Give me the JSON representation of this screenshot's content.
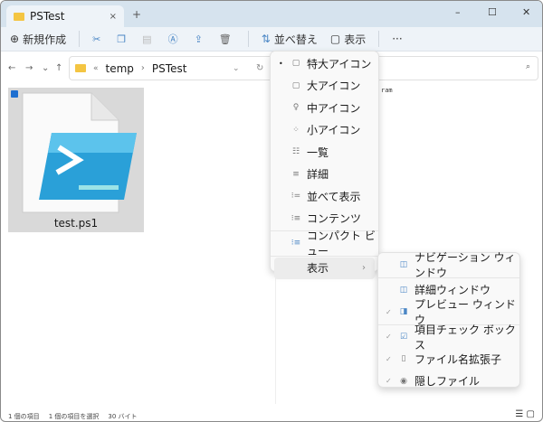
{
  "window": {
    "tab_title": "PSTest",
    "new_tab": "+",
    "close_tab": "×",
    "minimize": "–",
    "maximize": "☐",
    "close": "✕"
  },
  "toolbar": {
    "new": "新規作成",
    "sort": "並べ替え",
    "view": "表示",
    "more": "···"
  },
  "address": {
    "overflow": "«",
    "path": [
      "temp",
      "PSTest"
    ],
    "sep": "›"
  },
  "file": {
    "name": "test.ps1"
  },
  "preview": {
    "text": "ram"
  },
  "status": {
    "count": "1 個の項目",
    "selected": "1 個の項目を選択",
    "size": "30 バイト"
  },
  "view_menu": {
    "items": [
      {
        "label": "特大アイコン",
        "icon": "extra-large-icons-icon",
        "glyph": "▢",
        "bullet": "•"
      },
      {
        "label": "大アイコン",
        "icon": "large-icons-icon",
        "glyph": "▢"
      },
      {
        "label": "中アイコン",
        "icon": "medium-icons-icon",
        "glyph": "♀"
      },
      {
        "label": "小アイコン",
        "icon": "small-icons-icon",
        "glyph": "⁘"
      },
      {
        "label": "一覧",
        "icon": "list-icon",
        "glyph": "☷"
      },
      {
        "label": "詳細",
        "icon": "details-icon",
        "glyph": "≡"
      },
      {
        "label": "並べて表示",
        "icon": "tiles-icon",
        "glyph": "⁝="
      },
      {
        "label": "コンテンツ",
        "icon": "content-icon",
        "glyph": "⁝≡"
      },
      {
        "label": "コンパクト ビュー",
        "icon": "compact-view-icon",
        "glyph": "⁝≡"
      },
      {
        "label": "表示",
        "submenu": true,
        "arrow": "›"
      }
    ]
  },
  "show_submenu": {
    "items": [
      {
        "label": "ナビゲーション ウィンドウ",
        "icon": "navigation-pane-icon",
        "glyph": "◫",
        "checked": false
      },
      {
        "label": "詳細ウィンドウ",
        "icon": "details-pane-icon",
        "glyph": "◫",
        "checked": false
      },
      {
        "label": "プレビュー ウィンドウ",
        "icon": "preview-pane-icon",
        "glyph": "◨",
        "checked": true
      },
      {
        "label": "項目チェック ボックス",
        "icon": "item-checkbox-icon",
        "glyph": "☑",
        "checked": true
      },
      {
        "label": "ファイル名拡張子",
        "icon": "file-extension-icon",
        "glyph": "▯",
        "checked": true
      },
      {
        "label": "隠しファイル",
        "icon": "hidden-files-icon",
        "glyph": "◉",
        "checked": true
      }
    ],
    "check": "✓"
  }
}
